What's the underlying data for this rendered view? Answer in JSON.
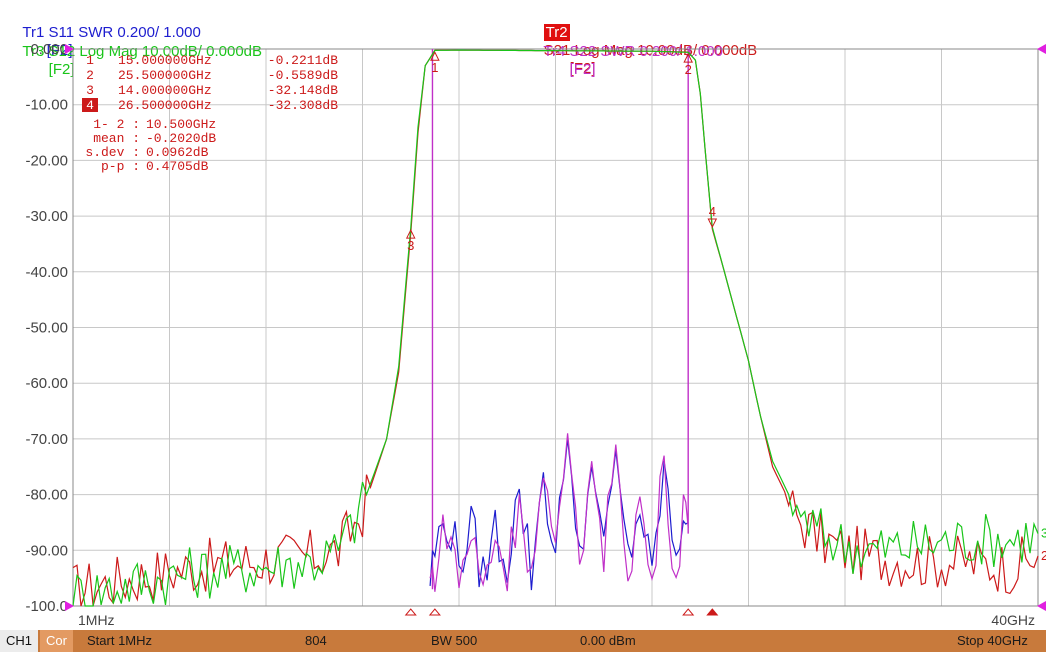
{
  "colors": {
    "tr1": "#1d1dcf",
    "tr2": "#cc1a1a",
    "tr3": "#19c519",
    "tr4": "#c030c8",
    "grid": "#c8c8c8",
    "frame": "#888888",
    "axis_text": "#444444",
    "marker_text": "#cc1a1a",
    "status_bg": "#c87a3c"
  },
  "header": {
    "tr1": {
      "label": "Tr1 S11 SWR 0.200/ 1.000",
      "key": "[F2]"
    },
    "tr2": {
      "badge": "Tr2",
      "label": "S21 Log Mag 10.00dB/ 0.000dB",
      "key": "[F2]"
    },
    "tr3": {
      "label": "Tr3 S12 Log Mag 10.00dB/ 0.000dB",
      "key": "[F2]"
    },
    "tr4": {
      "label": "Tr4 S22 SWR 0.200/ 1.000",
      "key": "[F2]"
    }
  },
  "markers": {
    "rows": [
      {
        "num": "1",
        "freq": "15.000000GHz",
        "value": "-0.2211dB",
        "active": false
      },
      {
        "num": "2",
        "freq": "25.500000GHz",
        "value": "-0.5589dB",
        "active": false
      },
      {
        "num": "3",
        "freq": "14.000000GHz",
        "value": "-32.148dB",
        "active": false
      },
      {
        "num": "4",
        "freq": "26.500000GHz",
        "value": "-32.308dB",
        "active": true
      }
    ],
    "stats": [
      {
        "label": "1- 2 :",
        "value": "10.500GHz"
      },
      {
        "label": "mean :",
        "value": "-0.2020dB"
      },
      {
        "label": "s.dev :",
        "value": "0.0962dB"
      },
      {
        "label": "p-p :",
        "value": "0.4705dB"
      }
    ]
  },
  "status_bar": {
    "channel": "CH1",
    "correction": "Cor",
    "start": "Start 1MHz",
    "points": "804",
    "bw": "BW 500",
    "power": "0.00 dBm",
    "stop": "Stop 40GHz"
  },
  "chart_data": {
    "type": "line",
    "title": "",
    "xlabel": "",
    "ylabel": "",
    "x_unit": "GHz",
    "xlim": [
      0.001,
      40
    ],
    "ylim": [
      -100,
      0
    ],
    "grid": true,
    "x_tick_labels": [
      "1MHz",
      "40GHz"
    ],
    "y_ticks": [
      0,
      -10,
      -20,
      -30,
      -40,
      -50,
      -60,
      -70,
      -80,
      -90,
      -100
    ],
    "y_tick_labels": [
      "0.000",
      "-10.00",
      "-20.00",
      "-30.00",
      "-40.00",
      "-50.00",
      "-60.00",
      "-70.00",
      "-80.00",
      "-90.00",
      "-100.0"
    ],
    "series": [
      {
        "name": "Tr2",
        "color": "#cc1a1a",
        "end_label": "2",
        "x": [
          0,
          5,
          10,
          11,
          12,
          13,
          13.5,
          14,
          14.3,
          14.6,
          15,
          16,
          18,
          20,
          22,
          24,
          25.5,
          25.8,
          26,
          26.2,
          26.5,
          27,
          27.5,
          28,
          28.5,
          29,
          30,
          31,
          32,
          33,
          35,
          37,
          39,
          40
        ],
        "y": [
          -97,
          -93,
          -91,
          -90,
          -83,
          -70,
          -58,
          -33,
          -15,
          -3,
          -0.22,
          -0.2,
          -0.25,
          -0.3,
          -0.35,
          -0.4,
          -0.56,
          -2,
          -8,
          -18,
          -32.3,
          -40,
          -48,
          -56,
          -66,
          -75,
          -84,
          -88,
          -90,
          -91,
          -92,
          -92,
          -93,
          -91
        ]
      },
      {
        "name": "Tr3",
        "color": "#19c519",
        "end_label": "3",
        "x": [
          0,
          5,
          10,
          11,
          12,
          13,
          13.5,
          14,
          14.3,
          14.6,
          15,
          16,
          18,
          20,
          22,
          24,
          25.5,
          25.8,
          26,
          26.2,
          26.5,
          27,
          27.5,
          28,
          28.5,
          29,
          30,
          31,
          32,
          33,
          35,
          37,
          39,
          40
        ],
        "y": [
          -98,
          -94,
          -92,
          -90,
          -82,
          -70,
          -57,
          -32,
          -14,
          -3,
          -0.25,
          -0.2,
          -0.25,
          -0.3,
          -0.35,
          -0.4,
          -0.6,
          -2,
          -8,
          -18,
          -32,
          -40,
          -48,
          -56,
          -66,
          -74,
          -83,
          -87,
          -89,
          -90,
          -89,
          -88,
          -88,
          -87
        ]
      },
      {
        "name": "Tr1",
        "color": "#1d1dcf",
        "end_label": "",
        "x": [
          14.8,
          15,
          15.5,
          16,
          16.5,
          17,
          17.5,
          18,
          18.5,
          19,
          19.5,
          20,
          20.5,
          21,
          21.5,
          22,
          22.5,
          23,
          23.5,
          24,
          24.5,
          25,
          25.3,
          25.5
        ],
        "y": [
          -95,
          -90,
          -84,
          -92,
          -86,
          -95,
          -86,
          -92,
          -79,
          -94,
          -76,
          -92,
          -70,
          -90,
          -75,
          -91,
          -72,
          -92,
          -82,
          -96,
          -74,
          -95,
          -82,
          -85
        ]
      },
      {
        "name": "Tr4",
        "color": "#c030c8",
        "end_label": "",
        "x": [
          14.8,
          15,
          15.5,
          16,
          16.5,
          17,
          17.5,
          18,
          18.5,
          19,
          19.5,
          20,
          20.5,
          21,
          21.5,
          22,
          22.5,
          23,
          23.5,
          24,
          24.5,
          25,
          25.3,
          25.5
        ],
        "y": [
          -96,
          -93,
          -85,
          -95,
          -87,
          -97,
          -87,
          -94,
          -80,
          -95,
          -77,
          -93,
          -69,
          -91,
          -74,
          -92,
          -71,
          -93,
          -81,
          -97,
          -73,
          -96,
          -80,
          -86
        ]
      }
    ],
    "vertical_traces": [
      {
        "name": "Tr4 edge low",
        "color": "#c030c8",
        "x": 14.9,
        "y_from": 0,
        "y_to": -97
      },
      {
        "name": "Tr4 edge high",
        "color": "#c030c8",
        "x": 25.5,
        "y_from": 0,
        "y_to": -87
      }
    ],
    "marker_points": [
      {
        "num": "1",
        "x": 15.0,
        "y": -0.22
      },
      {
        "num": "2",
        "x": 25.5,
        "y": -0.56
      },
      {
        "num": "3",
        "x": 14.0,
        "y": -32.15
      },
      {
        "num": "4",
        "x": 26.5,
        "y": -32.31
      }
    ]
  }
}
